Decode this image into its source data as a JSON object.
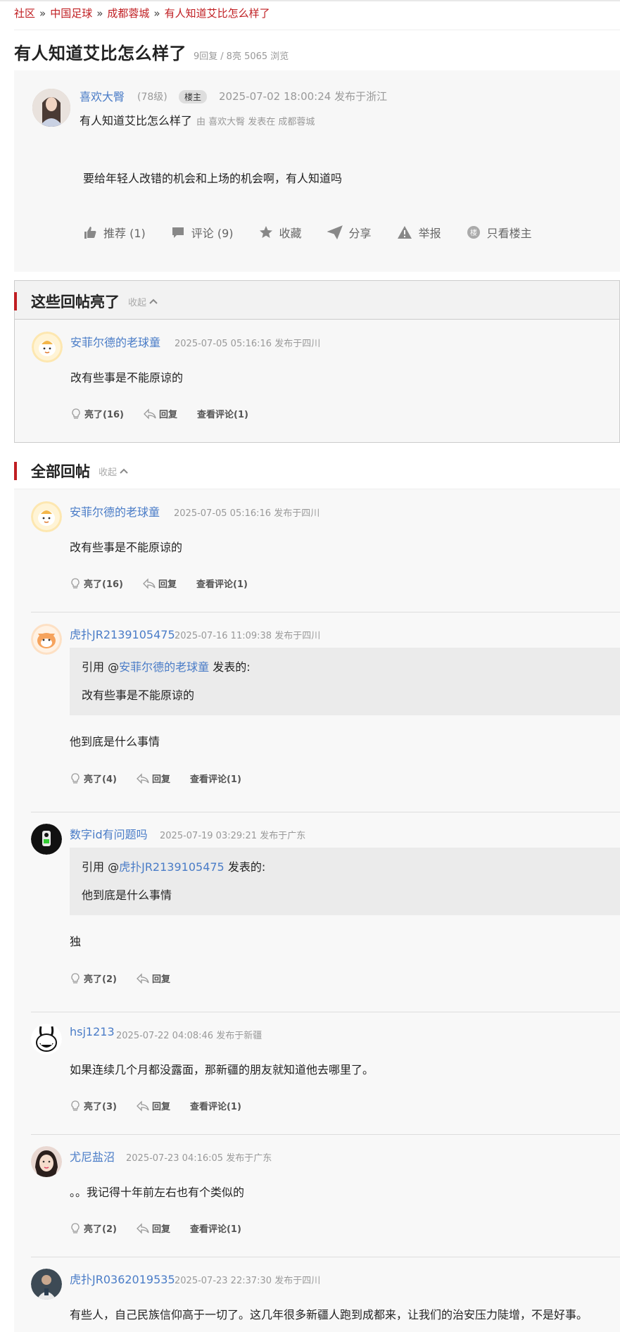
{
  "breadcrumb": {
    "items": [
      "社区",
      "中国足球",
      "成都蓉城",
      "有人知道艾比怎么样了"
    ],
    "separator": "»"
  },
  "thread": {
    "title": "有人知道艾比怎么样了",
    "replies": "9回复",
    "slash": "/",
    "lights": "8亮",
    "views": "5065 浏览"
  },
  "op": {
    "username": "喜欢大臀",
    "level": "(78级)",
    "badge": "楼主",
    "time": "2025-07-02 18:00:24  发布于浙江",
    "subtitle": "有人知道艾比怎么样了",
    "posted_in": "由  喜欢大臀 发表在  成都蓉城",
    "body": "要给年轻人改错的机会和上场的机会啊，有人知道吗",
    "actions": {
      "recommend": "推荐 (1)",
      "comment": "评论 (9)",
      "favorite": "收藏",
      "share": "分享",
      "report": "举报",
      "only_op": "只看楼主"
    },
    "only_op_icon_glyph": "楼"
  },
  "hot_section": {
    "title": "这些回帖亮了",
    "collapse": "收起",
    "reply": {
      "username": "安菲尔德的老球童",
      "time": "2025-07-05 05:16:16  发布于四川",
      "text": "改有些事是不能原谅的",
      "light": "亮了(16)",
      "reply": "回复",
      "view_comments": "查看评论(1)"
    }
  },
  "all_section": {
    "title": "全部回帖",
    "collapse": "收起",
    "replies": [
      {
        "username": "安菲尔德的老球童",
        "time": "2025-07-05 05:16:16  发布于四川",
        "text": "改有些事是不能原谅的",
        "light": "亮了(16)",
        "reply": "回复",
        "view_comments": "查看评论(1)"
      },
      {
        "username": "虎扑JR2139105475",
        "time": "2025-07-16 11:09:38  发布于四川",
        "quote_prefix": "引用 @",
        "quote_user": "安菲尔德的老球童",
        "quote_suffix": " 发表的:",
        "quote_text": "改有些事是不能原谅的",
        "text": "他到底是什么事情",
        "light": "亮了(4)",
        "reply": "回复",
        "view_comments": "查看评论(1)"
      },
      {
        "username": "数字id有问题吗",
        "time": "2025-07-19 03:29:21  发布于广东",
        "quote_prefix": "引用 @",
        "quote_user": "虎扑JR2139105475",
        "quote_suffix": " 发表的:",
        "quote_text": "他到底是什么事情",
        "text": "独",
        "light": "亮了(2)",
        "reply": "回复"
      },
      {
        "username": "hsj1213",
        "time": "2025-07-22 04:08:46  发布于新疆",
        "text": "如果连续几个月都没露面，那新疆的朋友就知道他去哪里了。",
        "light": "亮了(3)",
        "reply": "回复",
        "view_comments": "查看评论(1)"
      },
      {
        "username": "尤尼盐沼",
        "time": "2025-07-23 04:16:05  发布于广东",
        "text": "。。我记得十年前左右也有个类似的",
        "light": "亮了(2)",
        "reply": "回复",
        "view_comments": "查看评论(1)"
      },
      {
        "username": "虎扑JR0362019535",
        "time": "2025-07-23 22:37:30  发布于四川",
        "text": "有些人，自己民族信仰高于一切了。这几年很多新疆人跑到成都来，让我们的治安压力陡增，不是好事。"
      }
    ]
  },
  "colors": {
    "accent_red": "#c01e22",
    "link_blue": "#4a7cc7",
    "muted_gray": "#999999",
    "panel_bg": "#f7f7f7"
  }
}
